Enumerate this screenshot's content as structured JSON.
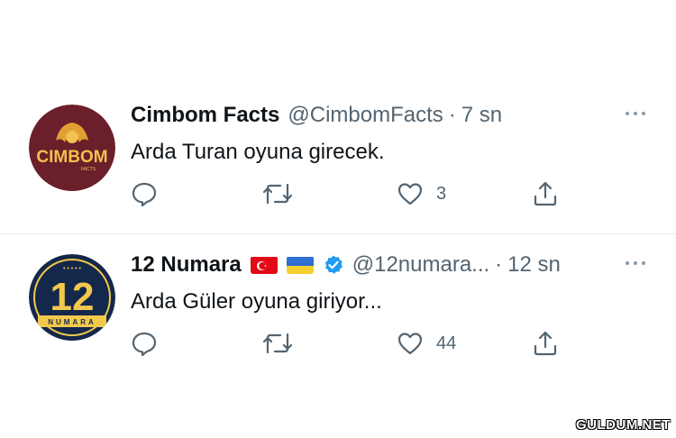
{
  "tweets": [
    {
      "name": "Cimbom Facts",
      "handle": "@CimbomFacts",
      "separator": "·",
      "time": "7 sn",
      "text": "Arda Turan oyuna girecek.",
      "likes": "3",
      "avatar_text": "CIMBOM",
      "avatar_subtext": "FACTS",
      "avatar_color": "#6b1f2a"
    },
    {
      "name": "12 Numara",
      "flags": [
        "turkey-flag",
        "ukraine-flag"
      ],
      "verified": true,
      "handle": "@12numara...",
      "separator": "·",
      "time": "12 sn",
      "text": "Arda Güler oyuna giriyor...",
      "likes": "44",
      "avatar_text": "12",
      "avatar_subtext": "NUMARA",
      "avatar_color": "#14284b"
    }
  ],
  "icons": [
    "reply-icon",
    "retweet-icon",
    "like-icon",
    "share-icon",
    "more-icon",
    "verified-icon"
  ],
  "watermark": "GULDUM.NET"
}
